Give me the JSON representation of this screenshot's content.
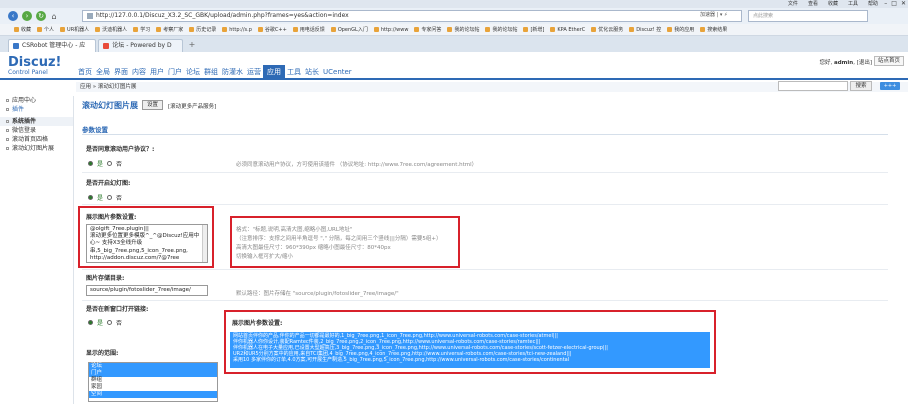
{
  "browser": {
    "menu": [
      "文件",
      "查看",
      "收藏",
      "工具",
      "帮助"
    ],
    "url": "http://127.0.0.1/Discuz_X3.2_SC_GBK/upload/admin.php?frames=yes&action=index",
    "addr_tools": "加速器 | ▾ ⚡",
    "search_placeholder": "点此搜索",
    "bookmarks": [
      "收藏",
      "个人",
      "UR机器人",
      "沃迪机器人",
      "学习",
      "考察厂家",
      "历史记录",
      "http://s.p",
      "谷歌C++",
      "用电话反馈",
      "OpenGL入门",
      "http://www",
      "专家问答",
      "我的论坛帖",
      "我的论坛帖",
      "[新增]",
      "KPA EtherC",
      "优化云服务",
      "Discuz! 控",
      "我的应用",
      "搜索结果"
    ],
    "tabs": [
      {
        "label": "CSRobot 管理中心 - 应"
      },
      {
        "label": "论坛 - Powered by D"
      }
    ]
  },
  "header": {
    "logo": "Discuz!",
    "logo_sub": "Control Panel",
    "nav": [
      "首页",
      "全局",
      "界面",
      "内容",
      "用户",
      "门户",
      "论坛",
      "群组",
      "防灌水",
      "运营",
      "应用",
      "工具",
      "站长",
      "UCenter"
    ],
    "active_nav": "应用",
    "user_greeting": "您好, ",
    "username": "admin",
    "logout": "[退出]",
    "site_home": "站点首页"
  },
  "breadcrumb": {
    "text": "应用 » 滚动幻灯图片展",
    "search_button": "搜索",
    "plus": "+++"
  },
  "sidebar": {
    "items": [
      {
        "label": "应用中心",
        "type": "item"
      },
      {
        "label": "插件",
        "type": "active"
      },
      {
        "label": "系统插件",
        "type": "group"
      },
      {
        "label": "微信登录",
        "type": "item"
      },
      {
        "label": "滚动首页四格",
        "type": "item"
      },
      {
        "label": "滚动幻灯图片展",
        "type": "item"
      }
    ]
  },
  "content": {
    "page_title": "滚动幻灯图片展",
    "settings_button": "设置",
    "more_link": "[滚动更多产品服务]",
    "section_title": "参数设置",
    "q1": "是否同意滚动用户协议？:",
    "q1_hint": "必须同意滚动用户协议，方可使用该插件 （协议地址: http://www.7ree.com/agreement.html）",
    "yes": "是",
    "no": "否",
    "q2": "是否开启幻灯图:",
    "q3": "展示图片参数设置:",
    "q3_text": "@olgift_7ree.plugin|||\n滚动更多位置更多模版^_^@Discuz!应用中\n心~ 支持X3全线升级\n串,5_big_7ree.png,5_icon_7ree.png,\nhttp://addon.discuz.com/?@7ree",
    "q3_notes": "格式：\"标题,说明,高清大图,缩略小图,URL地址\"\n（注意排序：支撑之间用半角逗号 \",\" 分隔，每之间用三个竖线|||分隔）需要5组+）\n高清大图最佳尺寸：960*390px 缩略小图最佳尺寸：80*40px\n切换输入框可扩大/缩小",
    "q4": "图片存储目录:",
    "q4_value": "source/plugin/fotoslider_7ree/image/",
    "q4_hint": "默认路径：图片存储在 \"source/plugin/fotoslider_7ree/image/\"",
    "q5": "是否在新窗口打开链接:",
    "q6": "展示图片参数设置:",
    "q6_lines": "网站首页伴你的产品,伴你的产品一切都是最好的,1_big_7ree.png,1_icon_7ree.png,http://www.universal-robots.com/case-stories/atmel|||\n伴你机器人你你设计,装配Ramtec件装,2_big_7ree.png,2_icon_7ree.png,http://www.universal-robots.com/case-stories/ramtec|||\n伴你机器人在电子大量应用,已设置大型超高压,3_big_7ree.png,3_icon_7ree.png,http://www.universal-robots.com/case-stories/scott-fetzer-electrical-group|||\nUR2和UR5分别方案中的应用,来自TCI集团,4_big_7ree.png,4_icon_7ree.png,http://www.universal-robots.com/case-stories/tci-new-zealand|||\n采用10 多家伴你的订单,4.0方案,可开展生产制造,5_big_7ree.png,5_icon_7ree.png,http://www.universal-robots.com/case-stories/continental",
    "q7": "显示的范围:",
    "groups": [
      "论坛",
      "门户",
      "群组",
      "家园",
      "空间"
    ],
    "groups_selected": [
      0,
      1,
      4
    ]
  }
}
